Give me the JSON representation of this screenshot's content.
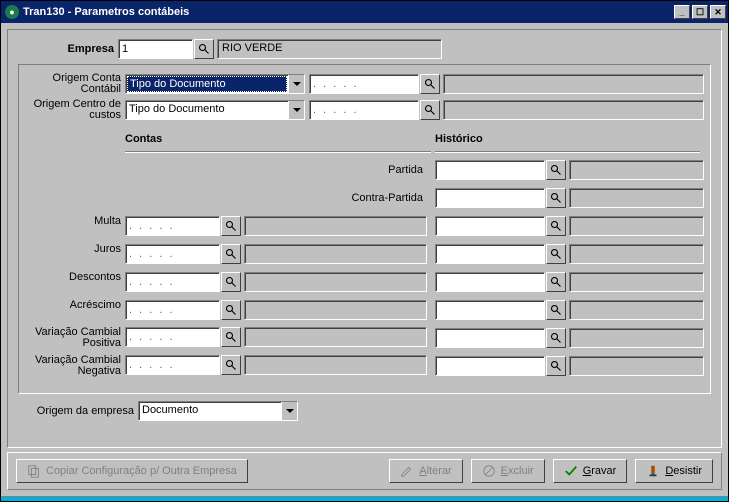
{
  "window": {
    "title": "Tran130 - Parametros contábeis"
  },
  "header": {
    "empresa_label": "Empresa",
    "empresa_value": "1",
    "empresa_name": "RIO VERDE"
  },
  "origem_conta": {
    "label": "Origem Conta Contábil",
    "combo_value": "Tipo do Documento",
    "code_value": ". . . . .",
    "desc_value": ""
  },
  "origem_centro": {
    "label": "Origem Centro de custos",
    "combo_value": "Tipo do Documento",
    "code_value": ". . . . .",
    "desc_value": ""
  },
  "sections": {
    "contas": "Contas",
    "historico": "Histórico"
  },
  "rows": {
    "partida": {
      "label": "Partida",
      "code": "",
      "hist": "",
      "desc": ""
    },
    "contra_partida": {
      "label": "Contra-Partida",
      "code": "",
      "hist": "",
      "desc": ""
    },
    "multa": {
      "label": "Multa",
      "code": ". . . . .",
      "desc": "",
      "hist": "",
      "hdesc": ""
    },
    "juros": {
      "label": "Juros",
      "code": ". . . . .",
      "desc": "",
      "hist": "",
      "hdesc": ""
    },
    "descontos": {
      "label": "Descontos",
      "code": ". . . . .",
      "desc": "",
      "hist": "",
      "hdesc": ""
    },
    "acrescimo": {
      "label": "Acréscimo",
      "code": ". . . . .",
      "desc": "",
      "hist": "",
      "hdesc": ""
    },
    "var_pos": {
      "label": "Variação Cambial Positiva",
      "code": ". . . . .",
      "desc": "",
      "hist": "",
      "hdesc": ""
    },
    "var_neg": {
      "label": "Variação Cambial Negativa",
      "code": ". . . . .",
      "desc": "",
      "hist": "",
      "hdesc": ""
    }
  },
  "origem_empresa": {
    "label": "Origem da empresa",
    "combo_value": "Documento"
  },
  "buttons": {
    "copiar": "Copiar Configuração p/ Outra Empresa",
    "alterar": "Alterar",
    "excluir": "Excluir",
    "gravar": "Gravar",
    "desistir": "Desistir"
  }
}
